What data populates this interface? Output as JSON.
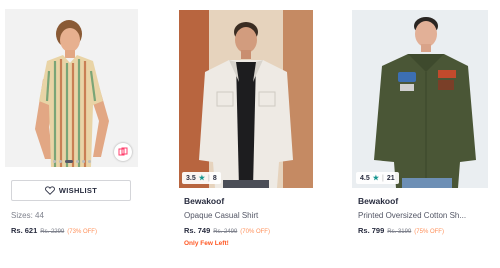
{
  "products": [
    {
      "image_alt": "Man in striped shirt",
      "wishlist_label": "WISHLIST",
      "sizes": "Sizes: 44",
      "price": "Rs. 621",
      "mrp": "Rs. 2299",
      "discount": "(73% OFF)"
    },
    {
      "rating": "3.5",
      "rating_count": "8",
      "brand": "Bewakoof",
      "title": "Opaque Casual Shirt",
      "price": "Rs. 749",
      "mrp": "Rs. 2499",
      "discount": "(70% OFF)",
      "stock_note": "Only Few Left!"
    },
    {
      "rating": "4.5",
      "rating_count": "21",
      "brand": "Bewakoof",
      "title": "Printed Oversized Cotton Sh...",
      "price": "Rs. 799",
      "mrp": "Rs. 3199",
      "discount": "(75% OFF)"
    }
  ],
  "colors": {
    "rating_star": "#14958f",
    "discount": "#ff905a",
    "stock_note": "#ff5722"
  }
}
